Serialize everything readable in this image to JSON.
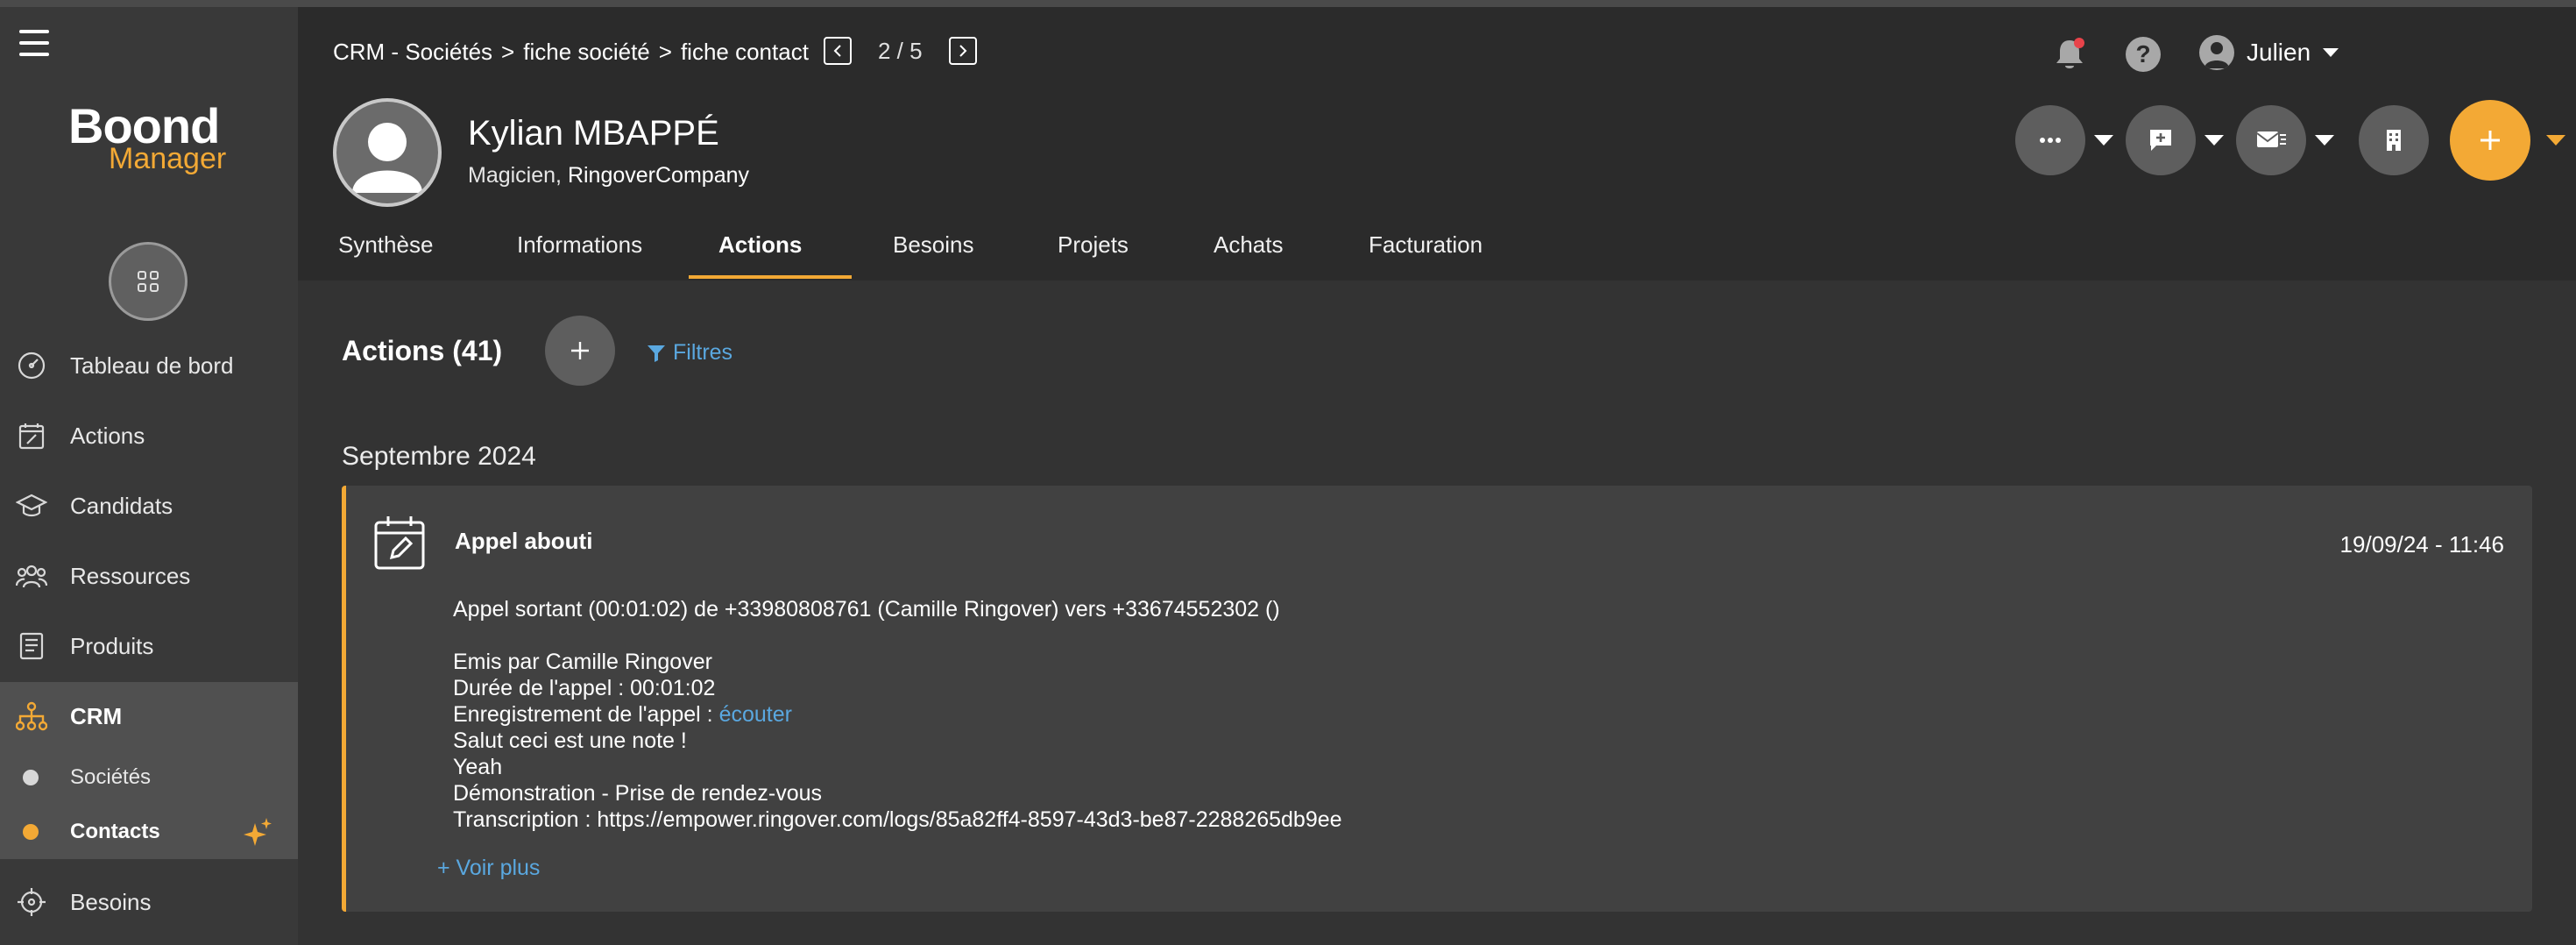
{
  "sidebar": {
    "logo_top": "Boond",
    "logo_bottom": "Manager",
    "items": [
      {
        "label": "Tableau de bord"
      },
      {
        "label": "Actions"
      },
      {
        "label": "Candidats"
      },
      {
        "label": "Ressources"
      },
      {
        "label": "Produits"
      },
      {
        "label": "CRM"
      },
      {
        "label": "Besoins"
      }
    ],
    "crm_sub": [
      {
        "label": "Sociétés"
      },
      {
        "label": "Contacts"
      }
    ]
  },
  "header": {
    "breadcrumb": [
      "CRM - Sociétés",
      "fiche société",
      "fiche contact"
    ],
    "breadcrumb_sep": ">",
    "pager": "2 / 5",
    "user_name": "Julien",
    "contact_name": "Kylian MBAPPÉ",
    "contact_role": "Magicien,",
    "contact_company": "RingoverCompany",
    "tabs": [
      {
        "label": "Synthèse"
      },
      {
        "label": "Informations"
      },
      {
        "label": "Actions"
      },
      {
        "label": "Besoins"
      },
      {
        "label": "Projets"
      },
      {
        "label": "Achats"
      },
      {
        "label": "Facturation"
      }
    ],
    "active_tab": "Actions"
  },
  "content": {
    "title": "Actions (41)",
    "filters_label": "Filtres",
    "month": "Septembre 2024",
    "card": {
      "title": "Appel abouti",
      "date": "19/09/24 - 11:46",
      "line1": "Appel sortant (00:01:02) de +33980808761 (Camille Ringover) vers +33674552302 ()",
      "line2": "Emis par Camille Ringover",
      "line3": "Durée de l'appel : 00:01:02",
      "line4_prefix": "Enregistrement de l'appel :",
      "line4_link": "écouter",
      "line5": "Salut ceci est une note !",
      "line6": "Yeah",
      "line7": "Démonstration - Prise de rendez-vous",
      "line8": "Transcription : https://empower.ringover.com/logs/85a82ff4-8597-43d3-be87-2288265db9ee",
      "voir_plus": "+ Voir plus"
    }
  },
  "colors": {
    "accent": "#f3a935",
    "link": "#5aa8e0",
    "sidebar_bg": "#393939",
    "content_bg": "#333333",
    "card_bg": "#414141",
    "notification_dot": "#e8434a"
  }
}
